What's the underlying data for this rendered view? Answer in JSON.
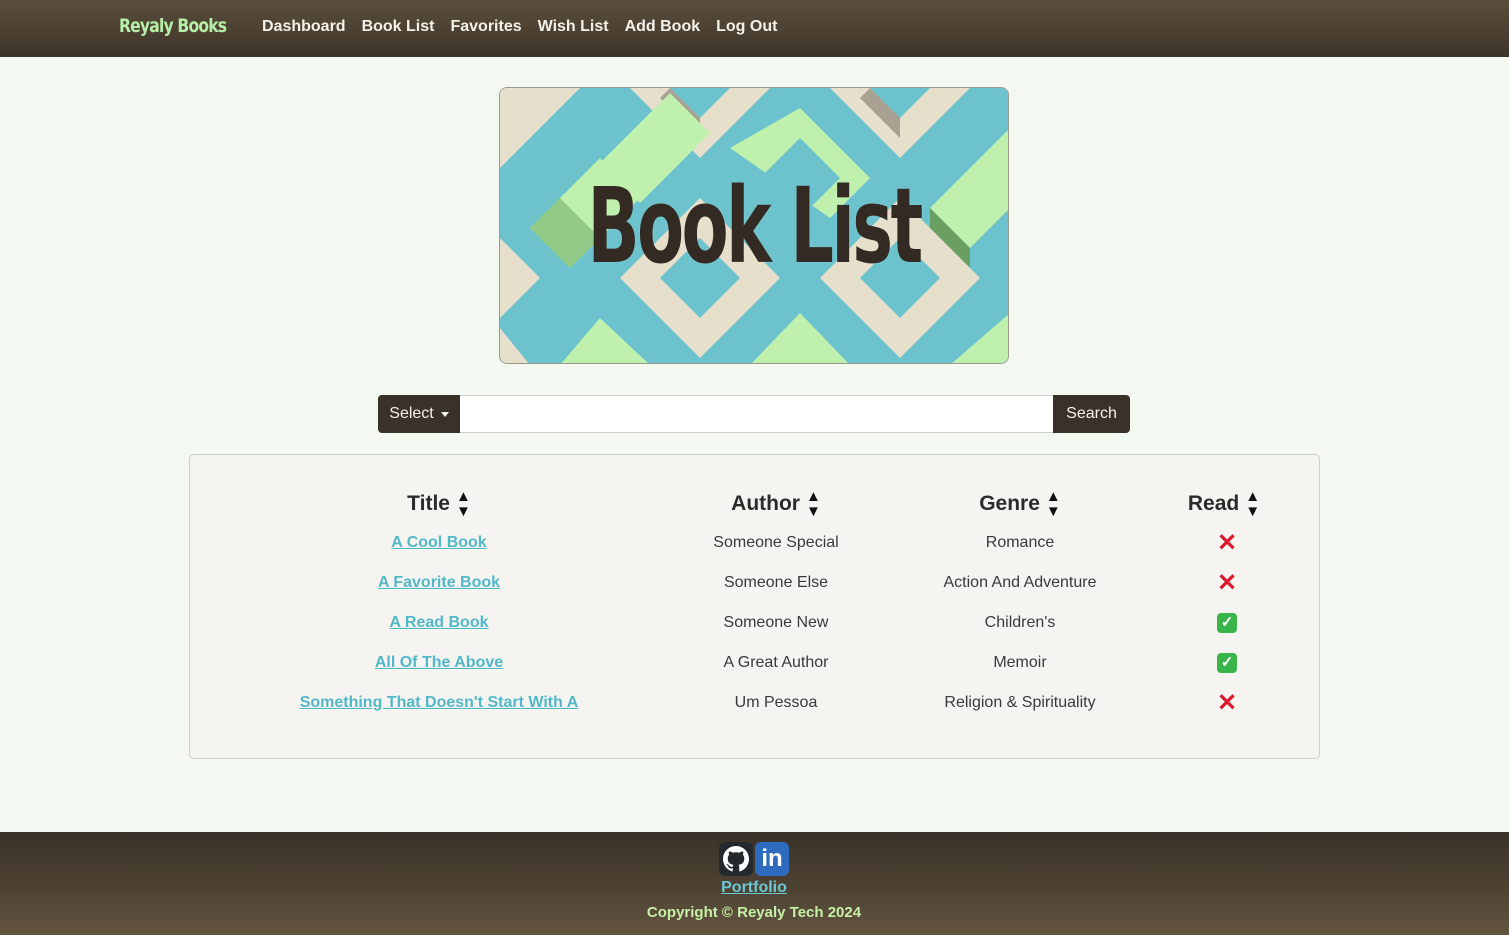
{
  "nav": {
    "brand": "Reyaly Books",
    "links": [
      "Dashboard",
      "Book List",
      "Favorites",
      "Wish List",
      "Add Book",
      "Log Out"
    ]
  },
  "banner": {
    "title": "Book List"
  },
  "search": {
    "select_label": "Select",
    "input_value": "",
    "button_label": "Search"
  },
  "table": {
    "columns": [
      "Title",
      "Author",
      "Genre",
      "Read"
    ],
    "rows": [
      {
        "title": "A Cool Book",
        "author": "Someone Special",
        "genre": "Romance",
        "read": false
      },
      {
        "title": "A Favorite Book",
        "author": "Someone Else",
        "genre": "Action And Adventure",
        "read": false
      },
      {
        "title": "A Read Book",
        "author": "Someone New",
        "genre": "Children's",
        "read": true
      },
      {
        "title": "All Of The Above",
        "author": "A Great Author",
        "genre": "Memoir",
        "read": true
      },
      {
        "title": "Something That Doesn't Start With A",
        "author": "Um Pessoa",
        "genre": "Religion & Spirituality",
        "read": false
      }
    ]
  },
  "footer": {
    "portfolio_label": "Portfolio",
    "copyright": "Copyright © Reyaly Tech 2024",
    "social_icons": [
      "github-icon",
      "linkedin-icon"
    ]
  },
  "colors": {
    "nav_bg": "#4a3f31",
    "brand": "#b6f0a8",
    "link": "#52b8c8",
    "button_bg": "#3a3128",
    "page_bg": "#f3f9f1",
    "read_no": "#d9182b",
    "read_yes": "#3bb54a"
  }
}
